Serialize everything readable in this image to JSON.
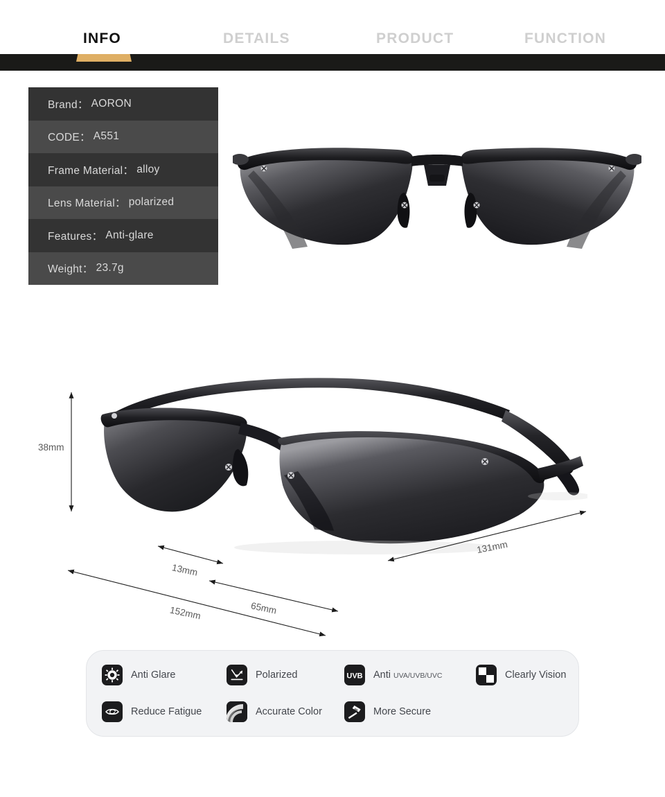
{
  "tabs": [
    {
      "label": "INFO",
      "active": true
    },
    {
      "label": "DETAILS",
      "active": false
    },
    {
      "label": "PRODUCT",
      "active": false
    },
    {
      "label": "FUNCTION",
      "active": false
    }
  ],
  "colors": {
    "accent_gold": "#dfaf64",
    "band_black": "#1a1a18",
    "row_dark": "#333333",
    "row_light": "#4a4a4a",
    "panel_bg": "#f2f3f5",
    "icon_bg": "#1c1c1e"
  },
  "spec_table": [
    {
      "label": "Brand：",
      "value": "AORON"
    },
    {
      "label": "CODE：",
      "value": "A551"
    },
    {
      "label": "Frame Material：",
      "value": "alloy"
    },
    {
      "label": "Lens Material：",
      "value": "polarized"
    },
    {
      "label": "Features：",
      "value": "Anti-glare"
    },
    {
      "label": "Weight：",
      "value": "23.7g"
    }
  ],
  "dimensions": {
    "height": "38mm",
    "bridge": "13mm",
    "total_width": "152mm",
    "lens_width": "65mm",
    "temple_arm": "131mm"
  },
  "features": [
    {
      "label": "Anti Glare",
      "sublabel": "",
      "icon": "sun-gear-icon"
    },
    {
      "label": "Polarized",
      "sublabel": "",
      "icon": "reflection-arrow-icon"
    },
    {
      "label": "Anti ",
      "sublabel": "UVA/UVB/UVC",
      "icon": "uvb-badge-icon"
    },
    {
      "label": "Clearly Vision",
      "sublabel": "",
      "icon": "checkerboard-icon"
    },
    {
      "label": "Reduce Fatigue",
      "sublabel": "",
      "icon": "eye-icon"
    },
    {
      "label": "Accurate Color",
      "sublabel": "",
      "icon": "color-arc-icon"
    },
    {
      "label": "More Secure",
      "sublabel": "",
      "icon": "hammer-icon"
    }
  ]
}
